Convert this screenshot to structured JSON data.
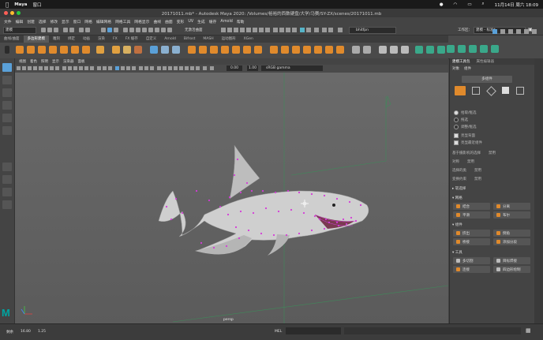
{
  "mac": {
    "apple": "",
    "app": "Maya",
    "window_menu": "窗口",
    "clock": "11月14日 周六 18:09"
  },
  "window": {
    "title": "20171011.mb* - Autodesk Maya 2020: /Volumes/裕裕的西数硬盘/大学/马赛/SY-ZX/scenes/20171011.mb"
  },
  "menu": [
    "文件",
    "编辑",
    "创建",
    "选择",
    "修改",
    "显示",
    "窗口",
    "网格",
    "编辑网格",
    "网格工具",
    "网格显示",
    "曲线",
    "曲面",
    "变形",
    "UV",
    "生成",
    "缓存",
    "Arnold",
    "帮助"
  ],
  "status": {
    "mode": "建模",
    "no_live": "无激活曲面",
    "renderer": "bhitfpn",
    "workspace_label": "工作区：",
    "workspace": "建模 - 标准*"
  },
  "shelf_tabs": [
    "曲线/曲面",
    "多边形建模",
    "雕刻",
    "绑定",
    "动画",
    "渲染",
    "FX",
    "FX 缓存",
    "自定义",
    "Arnold",
    "Bifrost",
    "MASH",
    "运动图形",
    "XGen"
  ],
  "shelf_active": 1,
  "viewport": {
    "menus": [
      "视图",
      "着色",
      "照明",
      "显示",
      "渲染器",
      "面板"
    ],
    "field1": "0.00",
    "field2": "1.00",
    "colorspace": "sRGB gamma",
    "camera": "persp"
  },
  "panel": {
    "tabs": [
      "建模工具包",
      "属性编辑器"
    ],
    "sub": [
      "对象",
      "组件"
    ],
    "mode_btn": "多组件",
    "select_opts": [
      "拾取/框选",
      "拖选",
      "调整/框选"
    ],
    "checks": [
      "亮显背面",
      "亮显最近组件"
    ],
    "camera_based": "基于摄影机的选择",
    "camera_based_val": "禁用",
    "symmetry": "对称",
    "symmetry_val": "禁用",
    "soft_sel": "选择的类",
    "soft_val": "禁用",
    "transform": "变换约束",
    "transform_val": "禁用",
    "sections": {
      "soft": "软选择",
      "mesh": "网格",
      "components": "组件",
      "tools": "工具"
    },
    "mesh_buttons": [
      "结合",
      "分离",
      "平滑",
      "布尔"
    ],
    "comp_buttons": [
      "挤出",
      "倒角",
      "桥接",
      "添加分段"
    ],
    "tool_buttons": [
      "多切割",
      "目标焊接",
      "连接",
      "四边形绘制"
    ]
  },
  "bottom": {
    "logo": "M",
    "left_label": "剩余",
    "val1": "16.80",
    "val2": "1.25",
    "mel": "MEL"
  },
  "colors": {
    "accent": "#3fa6e0",
    "selection": "#d43bd8",
    "shark": "#cfcfcf",
    "logo": "#00a4a0"
  }
}
